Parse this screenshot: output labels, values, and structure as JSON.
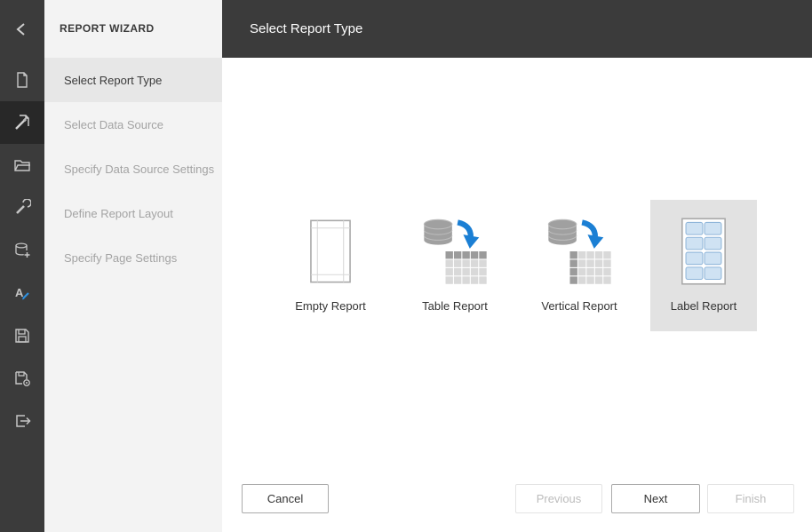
{
  "colors": {
    "toolbar_bg": "#3b3b3b",
    "toolbar_selected_bg": "#282828",
    "panel_bg": "#f3f3f3",
    "active_step_bg": "#e7e7e7",
    "header_bg": "#3b3b3b",
    "accent_blue": "#1b7fd4",
    "selected_tile_bg": "#e2e2e2"
  },
  "toolbar": {
    "icons": [
      {
        "name": "back"
      },
      {
        "name": "new-report"
      },
      {
        "name": "report-wizard",
        "selected": true
      },
      {
        "name": "open-report"
      },
      {
        "name": "edit-tools"
      },
      {
        "name": "add-data-source"
      },
      {
        "name": "localization"
      },
      {
        "name": "save"
      },
      {
        "name": "save-as"
      },
      {
        "name": "exit"
      }
    ]
  },
  "wizard_panel": {
    "title": "REPORT WIZARD",
    "steps": [
      {
        "label": "Select Report Type",
        "state": "active"
      },
      {
        "label": "Select Data Source",
        "state": "disabled"
      },
      {
        "label": "Specify Data Source Settings",
        "state": "disabled"
      },
      {
        "label": "Define Report Layout",
        "state": "disabled"
      },
      {
        "label": "Specify Page Settings",
        "state": "disabled"
      }
    ]
  },
  "header": {
    "title": "Select Report Type"
  },
  "report_types": [
    {
      "label": "Empty Report",
      "selected": false
    },
    {
      "label": "Table Report",
      "selected": false
    },
    {
      "label": "Vertical Report",
      "selected": false
    },
    {
      "label": "Label Report",
      "selected": true
    }
  ],
  "footer": {
    "cancel_label": "Cancel",
    "previous_label": "Previous",
    "next_label": "Next",
    "finish_label": "Finish"
  }
}
